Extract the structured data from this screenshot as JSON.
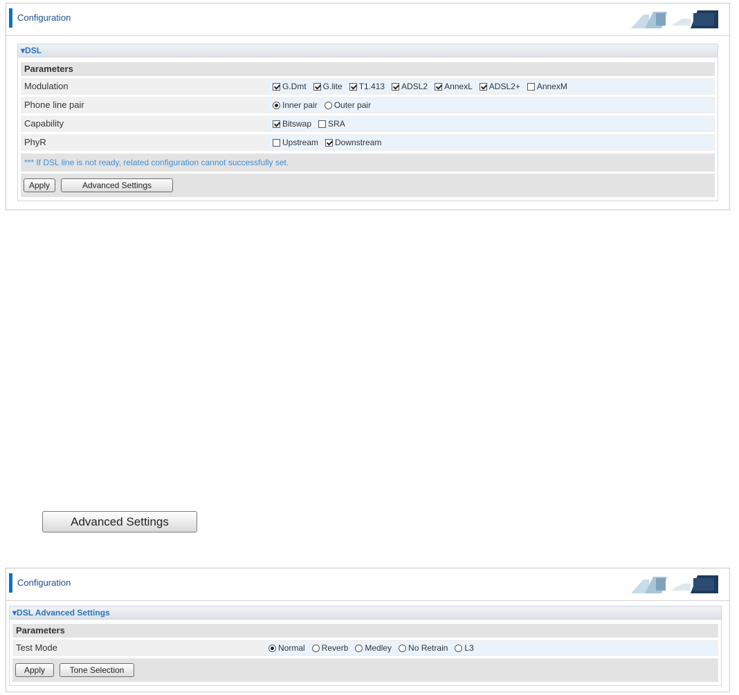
{
  "panel1": {
    "header_title": "Configuration",
    "section_title": "▾DSL",
    "parameters_label": "Parameters",
    "rows": {
      "modulation": {
        "label": "Modulation",
        "options": [
          {
            "label": "G.Dmt",
            "checked": true
          },
          {
            "label": "G.lite",
            "checked": true
          },
          {
            "label": "T1.413",
            "checked": true
          },
          {
            "label": "ADSL2",
            "checked": true
          },
          {
            "label": "AnnexL",
            "checked": true
          },
          {
            "label": "ADSL2+",
            "checked": true
          },
          {
            "label": "AnnexM",
            "checked": false
          }
        ]
      },
      "phone_line_pair": {
        "label": "Phone line pair",
        "options": [
          {
            "label": "Inner pair",
            "selected": true
          },
          {
            "label": "Outer pair",
            "selected": false
          }
        ]
      },
      "capability": {
        "label": "Capability",
        "options": [
          {
            "label": "Bitswap",
            "checked": true
          },
          {
            "label": "SRA",
            "checked": false
          }
        ]
      },
      "phyr": {
        "label": "PhyR",
        "options": [
          {
            "label": "Upstream",
            "checked": false
          },
          {
            "label": "Downstream",
            "checked": true
          }
        ]
      }
    },
    "note": "*** If DSL line is not ready, related configuration cannot successfully set.",
    "apply_label": "Apply",
    "advanced_label": "Advanced Settings"
  },
  "standalone_button_label": "Advanced Settings",
  "panel2": {
    "header_title": "Configuration",
    "section_title": "▾DSL Advanced Settings",
    "parameters_label": "Parameters",
    "test_mode": {
      "label": "Test Mode",
      "options": [
        {
          "label": "Normal",
          "selected": true
        },
        {
          "label": "Reverb",
          "selected": false
        },
        {
          "label": "Medley",
          "selected": false
        },
        {
          "label": "No Retrain",
          "selected": false
        },
        {
          "label": "L3",
          "selected": false
        }
      ]
    },
    "apply_label": "Apply",
    "tone_label": "Tone Selection"
  },
  "colors": {
    "accent": "#0a74c4",
    "section_title": "#2b73b9",
    "note": "#3d8fd4"
  }
}
